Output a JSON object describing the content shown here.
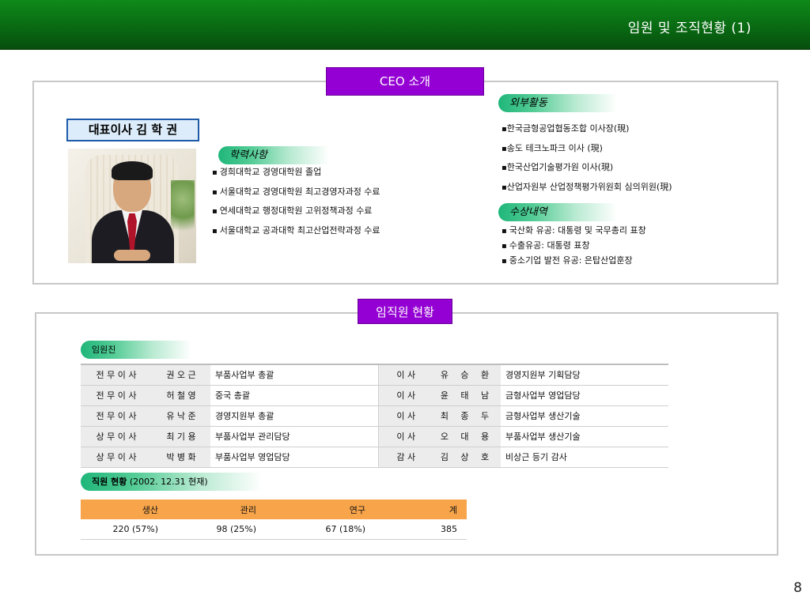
{
  "header": {
    "title": "임원 및 조직현황 (1)"
  },
  "ceo_section": {
    "tab_label": "CEO 소개",
    "name_box": "대표이사 김 학 권",
    "education": {
      "title": "학력사항",
      "items": [
        "경희대학교 경영대학원 졸업",
        "서울대학교 경영대학원 최고경영자과정 수료",
        "연세대학교 행정대학원 고위정책과정 수료",
        "서울대학교 공과대학 최고산업전략과정 수료"
      ]
    },
    "external": {
      "title": "외부활동",
      "items": [
        "한국금형공업협동조합 이사장(現)",
        "송도 테크노파크 이사 (現)",
        "한국산업기술평가원 이사(現)",
        "산업자원부 산업정책평가위원회 심의위원(現)"
      ]
    },
    "awards": {
      "title": "수상내역",
      "items": [
        "국산화 유공: 대통령 및 국무총리 표창",
        "수출유공: 대통령 표창",
        "중소기업 발전 유공: 은탑산업훈장"
      ]
    }
  },
  "employee_section": {
    "tab_label": "임직원 현황",
    "executives": {
      "title": "임원진",
      "rows": [
        [
          "전 무 이 사",
          "권 오 근",
          "부품사업부 총괄",
          "이 사",
          "유 승 환",
          "경영지원부 기획담당"
        ],
        [
          "전 무 이 사",
          "허 철 영",
          "중국 총괄",
          "이 사",
          "윤 태 남",
          "금형사업부 영업담당"
        ],
        [
          "전 무 이 사",
          "유 낙 준",
          "경영지원부 총괄",
          "이 사",
          "최 종 두",
          "금형사업부 생산기술"
        ],
        [
          "상 무 이 사",
          "최 기 용",
          "부품사업부 관리담당",
          "이 사",
          "오 대 용",
          "부품사업부 생산기술"
        ],
        [
          "상 무 이 사",
          "박 병 화",
          "부품사업부 영업담당",
          "감 사",
          "김 상 호",
          "비상근 등기 감사"
        ]
      ]
    },
    "staff": {
      "title": "직원 현황",
      "subtitle": "(2002. 12.31 현재)",
      "headers": [
        "생산",
        "관리",
        "연구",
        "계"
      ],
      "values": [
        "220 (57%)",
        "98 (25%)",
        "67 (18%)",
        "385"
      ]
    }
  },
  "page_number": "8",
  "colors": {
    "header_green": "#0a7014",
    "tab_purple": "#9400d3",
    "pill_green": "#1fb67a",
    "staff_header_orange": "#f7a44a",
    "name_box_border": "#1e5aa8"
  }
}
